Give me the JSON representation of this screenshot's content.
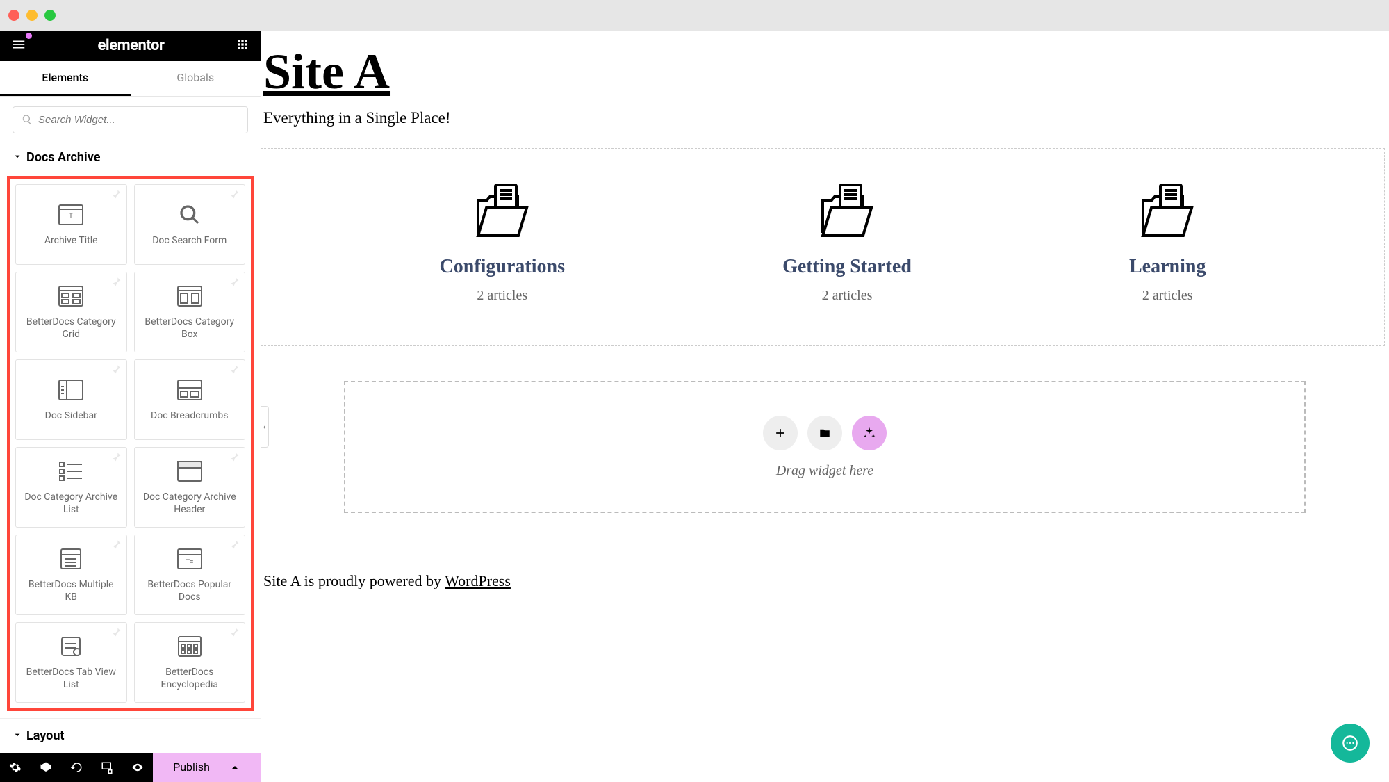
{
  "panel": {
    "title": "elementor",
    "tabs": {
      "elements": "Elements",
      "globals": "Globals"
    },
    "search": {
      "placeholder": "Search Widget..."
    },
    "sections": {
      "docs_archive": "Docs Archive",
      "layout": "Layout"
    },
    "widgets": [
      {
        "label": "Archive Title",
        "icon": "title"
      },
      {
        "label": "Doc Search Form",
        "icon": "search"
      },
      {
        "label": "BetterDocs Category Grid",
        "icon": "grid"
      },
      {
        "label": "BetterDocs Category Box",
        "icon": "box"
      },
      {
        "label": "Doc Sidebar",
        "icon": "sidebar"
      },
      {
        "label": "Doc Breadcrumbs",
        "icon": "breadcrumbs"
      },
      {
        "label": "Doc Category Archive List",
        "icon": "list"
      },
      {
        "label": "Doc Category Archive Header",
        "icon": "header"
      },
      {
        "label": "BetterDocs Multiple KB",
        "icon": "multikb"
      },
      {
        "label": "BetterDocs Popular Docs",
        "icon": "popular"
      },
      {
        "label": "BetterDocs Tab View List",
        "icon": "tabview"
      },
      {
        "label": "BetterDocs Encyclopedia",
        "icon": "encyclopedia"
      }
    ],
    "footer": {
      "publish": "Publish"
    }
  },
  "canvas": {
    "site_title": "Site A",
    "subtitle": "Everything in a Single Place!",
    "categories": [
      {
        "title": "Configurations",
        "count": "2 articles"
      },
      {
        "title": "Getting Started",
        "count": "2 articles"
      },
      {
        "title": "Learning",
        "count": "2 articles"
      }
    ],
    "dropzone": {
      "text": "Drag widget here"
    },
    "footer": {
      "prefix": "Site A is proudly powered by ",
      "link": "WordPress"
    }
  }
}
